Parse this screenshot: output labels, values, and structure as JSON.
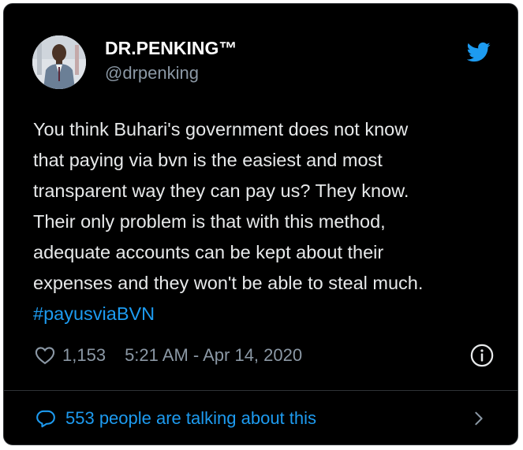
{
  "author": {
    "display_name": "DR.PENKING™",
    "handle": "@drpenking"
  },
  "tweet": {
    "text": "You think Buhari's government does not know\nthat paying via bvn is the easiest and most\ntransparent way they can pay us? They know.\nTheir only problem is that with this method,\nadequate accounts can be kept about their\nexpenses and they won't be able to steal much.",
    "hashtag": "#payusviaBVN"
  },
  "meta": {
    "likes": "1,153",
    "timestamp": "5:21 AM - Apr 14, 2020"
  },
  "footer": {
    "talking_label": "553 people are talking about this"
  },
  "icons": {
    "brand": "twitter-bird-icon",
    "like": "heart-icon",
    "info": "info-icon",
    "conversation": "speech-bubble-icon",
    "more": "chevron-right-icon"
  },
  "colors": {
    "background": "#000000",
    "text": "#e7e9ea",
    "secondary_text": "#8b98a5",
    "accent": "#1d9bf0",
    "border": "#2f3336"
  }
}
